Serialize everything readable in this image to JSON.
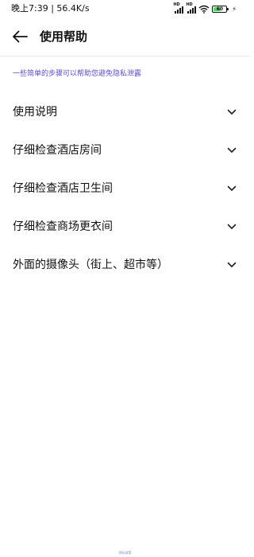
{
  "status_bar": {
    "time": "晚上7:39",
    "separator": "|",
    "speed": "56.4K/s",
    "sim1_label": "HD",
    "sim2_label": "HD",
    "battery_level": "60",
    "icons": [
      "signal-icon",
      "signal-icon",
      "wifi-icon",
      "battery-icon",
      "charging-icon"
    ]
  },
  "header": {
    "back_icon": "arrow-left-icon",
    "title": "使用帮助"
  },
  "hint": "一些简单的步骤可以帮助您避免隐私泄露",
  "items": [
    {
      "label": "使用说明",
      "icon": "chevron-down-icon"
    },
    {
      "label": "仔细检查酒店房间",
      "icon": "chevron-down-icon"
    },
    {
      "label": "仔细检查酒店卫生间",
      "icon": "chevron-down-icon"
    },
    {
      "label": "仔细检查商场更衣间",
      "icon": "chevron-down-icon"
    },
    {
      "label": "外面的摄像头（街上、超市等）",
      "icon": "chevron-down-icon"
    }
  ],
  "footer": "隐私政策",
  "colors": {
    "accent": "#5b4fc0",
    "battery_fill": "#4cd964",
    "footer_link": "#7b8fd8"
  }
}
